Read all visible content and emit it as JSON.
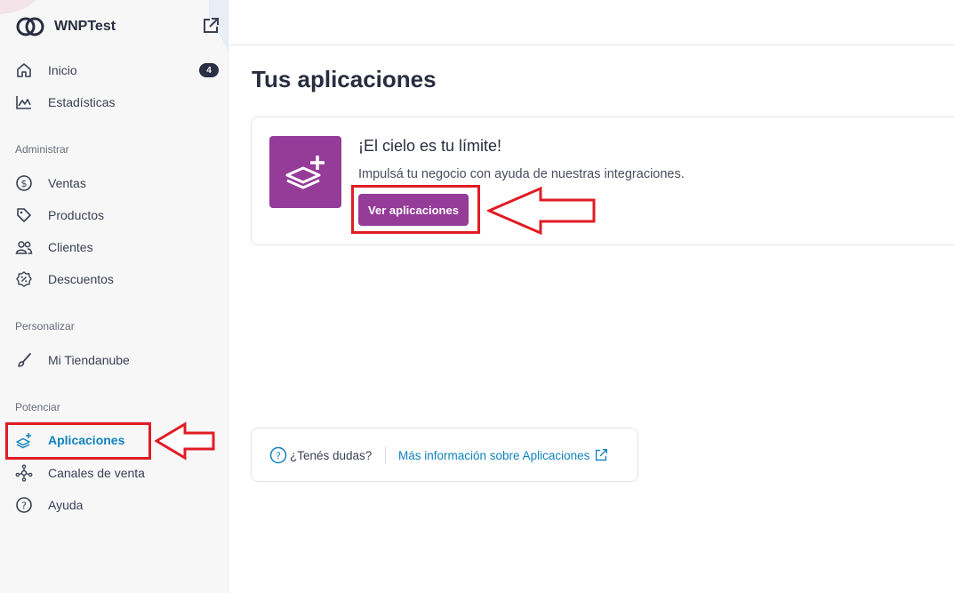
{
  "brand": {
    "name": "WNPTest"
  },
  "sidebar": {
    "top_items": [
      {
        "label": "Inicio",
        "icon": "home-icon",
        "badge": "4"
      },
      {
        "label": "Estadísticas",
        "icon": "chart-icon"
      }
    ],
    "sections": [
      {
        "title": "Administrar",
        "items": [
          {
            "label": "Ventas",
            "icon": "dollar-icon"
          },
          {
            "label": "Productos",
            "icon": "tag-icon"
          },
          {
            "label": "Clientes",
            "icon": "users-icon"
          },
          {
            "label": "Descuentos",
            "icon": "percent-badge-icon"
          }
        ]
      },
      {
        "title": "Personalizar",
        "items": [
          {
            "label": "Mi Tiendanube",
            "icon": "brush-icon"
          }
        ]
      },
      {
        "title": "Potenciar",
        "items": [
          {
            "label": "Aplicaciones",
            "icon": "apps-layers-icon",
            "active": true
          },
          {
            "label": "Canales de venta",
            "icon": "channels-icon"
          },
          {
            "label": "Ayuda",
            "icon": "question-icon"
          }
        ]
      }
    ]
  },
  "main": {
    "title": "Tus aplicaciones",
    "promo": {
      "title": "¡El cielo es tu límite!",
      "description": "Impulsá tu negocio con ayuda de nuestras integraciones.",
      "button_label": "Ver aplicaciones"
    },
    "help": {
      "question": "¿Tenés dudas?",
      "link_label": "Más información sobre Aplicaciones"
    }
  },
  "colors": {
    "accent_purple": "#953b98",
    "link_blue": "#0f82bd",
    "annotation_red": "#e01c24"
  }
}
